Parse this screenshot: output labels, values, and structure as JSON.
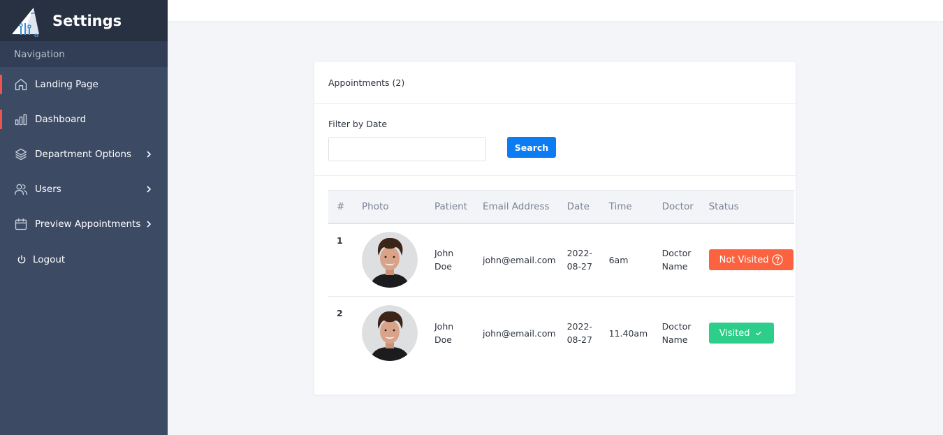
{
  "app": {
    "title": "Settings"
  },
  "sidebar": {
    "section_label": "Navigation",
    "items": [
      {
        "label": "Landing Page",
        "icon": "home-icon"
      },
      {
        "label": "Dashboard",
        "icon": "bar-chart-icon"
      },
      {
        "label": "Department Options",
        "icon": "layers-icon"
      },
      {
        "label": "Users",
        "icon": "users-icon"
      },
      {
        "label": "Preview Appointments",
        "icon": "calendar-icon"
      }
    ],
    "logout_label": "Logout"
  },
  "card": {
    "title": "Appointments (2)",
    "filter_label": "Filter by Date",
    "filter_value": "",
    "search_label": "Search"
  },
  "table": {
    "headers": [
      "#",
      "Photo",
      "Patient",
      "Email Address",
      "Date",
      "Time",
      "Doctor",
      "Status"
    ],
    "rows": [
      {
        "num": "1",
        "patient_first": "John",
        "patient_last": "Doe",
        "email": "john@email.com",
        "date_1": "2022-",
        "date_2": "08-27",
        "time": "6am",
        "doctor_1": "Doctor",
        "doctor_2": "Name",
        "status": "Not Visited"
      },
      {
        "num": "2",
        "patient_first": "John",
        "patient_last": "Doe",
        "email": "john@email.com",
        "date_1": "2022-",
        "date_2": "08-27",
        "time": "11.40am",
        "doctor_1": "Doctor",
        "doctor_2": "Name",
        "status": "Visited"
      }
    ]
  },
  "colors": {
    "sidebar_bg": "#3c4a64",
    "brand_bg": "#283142",
    "accent_marker": "#ef5350",
    "primary": "#0d7cf2",
    "not_visited": "#fb6340",
    "visited": "#2dce89"
  }
}
